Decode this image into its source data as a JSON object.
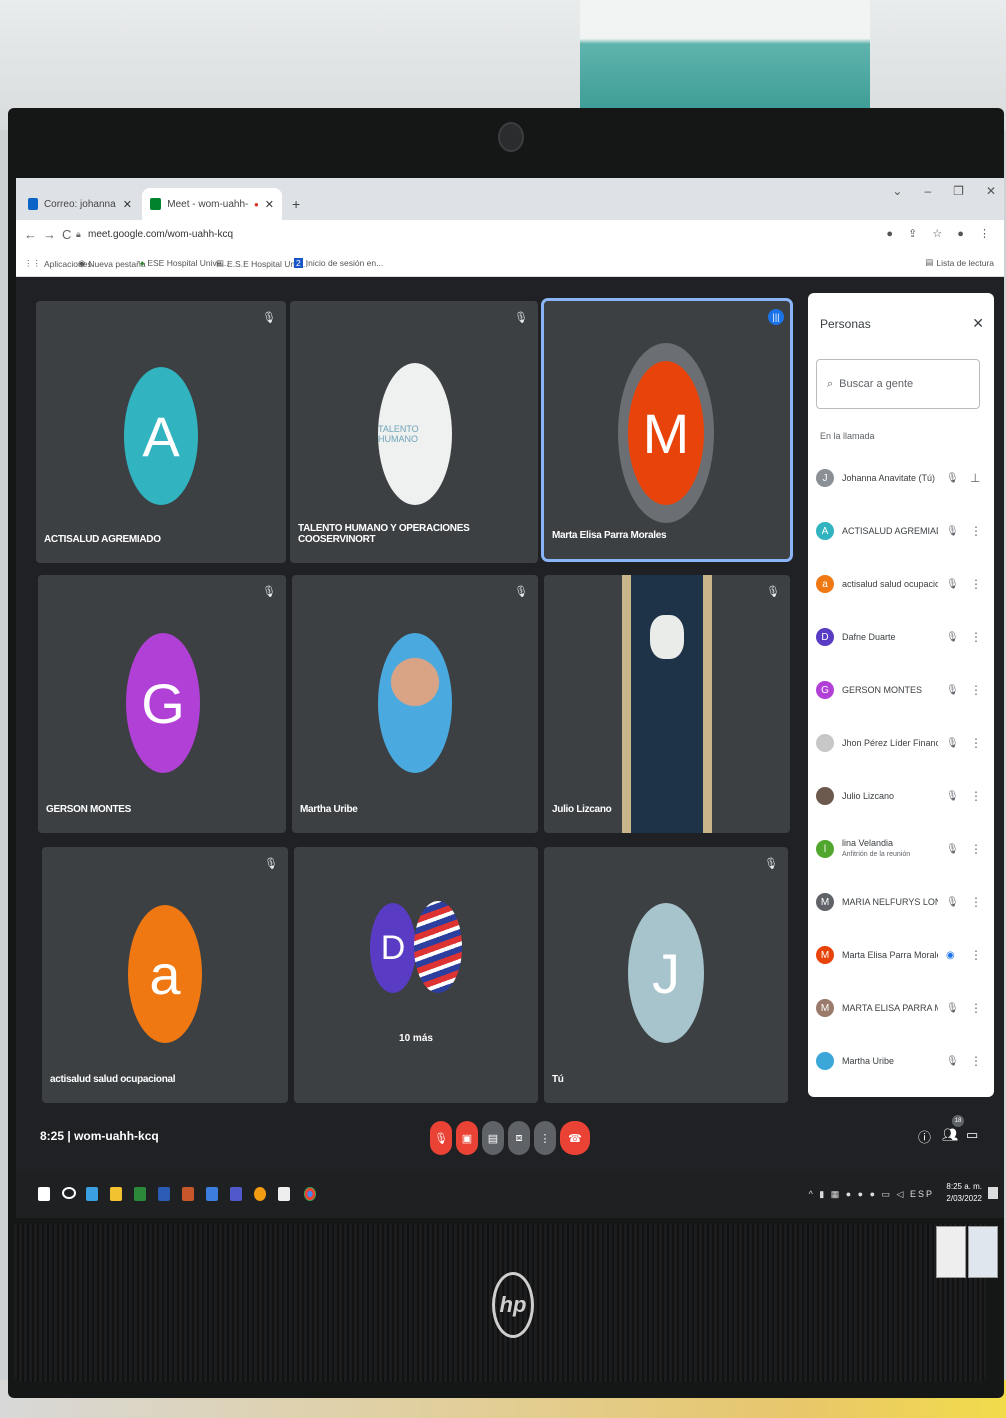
{
  "browser": {
    "tabs": [
      {
        "label": "Correo: johanna anavitate - Outl",
        "color": "#0a64c8"
      },
      {
        "label": "Meet - wom-uahh-kcq",
        "color": "#00832d"
      }
    ],
    "url": "meet.google.com/wom-uahh-kcq",
    "bookmarks": [
      "Aplicaciones",
      "Nueva pestaña",
      "ESE Hospital Unive...",
      "E.S.E Hospital Univ...",
      "Inicio de sesión en..."
    ],
    "reading_list": "Lista de lectura"
  },
  "tiles": [
    {
      "name": "ACTISALUD AGREMIADO",
      "initial": "A",
      "color": "#31b3c0",
      "type": "avatar"
    },
    {
      "name": "TALENTO HUMANO Y OPERACIONES COOSERVINORT",
      "initial": "",
      "color": "#e9ecef",
      "type": "photo",
      "photo_text": "TALENTO HUMANO"
    },
    {
      "name": "Marta Elisa Parra Morales",
      "initial": "M",
      "color": "#e8430a",
      "type": "avatar-speaking"
    },
    {
      "name": "GERSON MONTES",
      "initial": "G",
      "color": "#b140d6",
      "type": "avatar"
    },
    {
      "name": "Martha Uribe",
      "initial": "",
      "color": "#3aa7d8",
      "type": "photo"
    },
    {
      "name": "Julio Lizcano",
      "initial": "",
      "color": "#2b2f33",
      "type": "video"
    },
    {
      "name": "actisalud salud ocupacional",
      "initial": "a",
      "color": "#f07813",
      "type": "avatar"
    },
    {
      "name": "10 más",
      "initial": "D",
      "color": "#5a3bc4",
      "type": "group"
    },
    {
      "name": "Tú",
      "initial": "J",
      "color": "#a7c4cc",
      "type": "avatar"
    }
  ],
  "panel": {
    "title": "Personas",
    "search_placeholder": "Buscar a gente",
    "section": "En la llamada",
    "people": [
      {
        "name": "Johanna Anavitate (Tú)",
        "initial": "J",
        "color": "#8a9095",
        "sub": ""
      },
      {
        "name": "ACTISALUD AGREMIADO",
        "initial": "A",
        "color": "#31b3c0",
        "sub": ""
      },
      {
        "name": "actisalud salud ocupacio...",
        "initial": "a",
        "color": "#f07813",
        "sub": ""
      },
      {
        "name": "Dafne Duarte",
        "initial": "D",
        "color": "#5a3bc4",
        "sub": ""
      },
      {
        "name": "GERSON MONTES",
        "initial": "G",
        "color": "#b140d6",
        "sub": ""
      },
      {
        "name": "Jhon Pérez Líder Financie...",
        "initial": "",
        "color": "#c7c7c7",
        "sub": ""
      },
      {
        "name": "Julio Lizcano",
        "initial": "",
        "color": "#6b5a4d",
        "sub": ""
      },
      {
        "name": "lina Velandia",
        "initial": "l",
        "color": "#51a62d",
        "sub": "Anfitrión de la reunión"
      },
      {
        "name": "MARIA NELFURYS LOND...",
        "initial": "M",
        "color": "#5f6368",
        "sub": ""
      },
      {
        "name": "Marta Elisa Parra Morales",
        "initial": "M",
        "color": "#e8430a",
        "sub": ""
      },
      {
        "name": "MARTA ELISA PARRA MO...",
        "initial": "M",
        "color": "#9a7a6a",
        "sub": ""
      },
      {
        "name": "Martha Uribe",
        "initial": "",
        "color": "#3aa7d8",
        "sub": ""
      }
    ]
  },
  "bar": {
    "time": "8:25",
    "meeting_code": "wom-uahh-kcq",
    "participants_badge": "18"
  },
  "taskbar": {
    "lang": "ESP",
    "clock_time": "8:25 a. m.",
    "clock_date": "2/03/2022"
  }
}
